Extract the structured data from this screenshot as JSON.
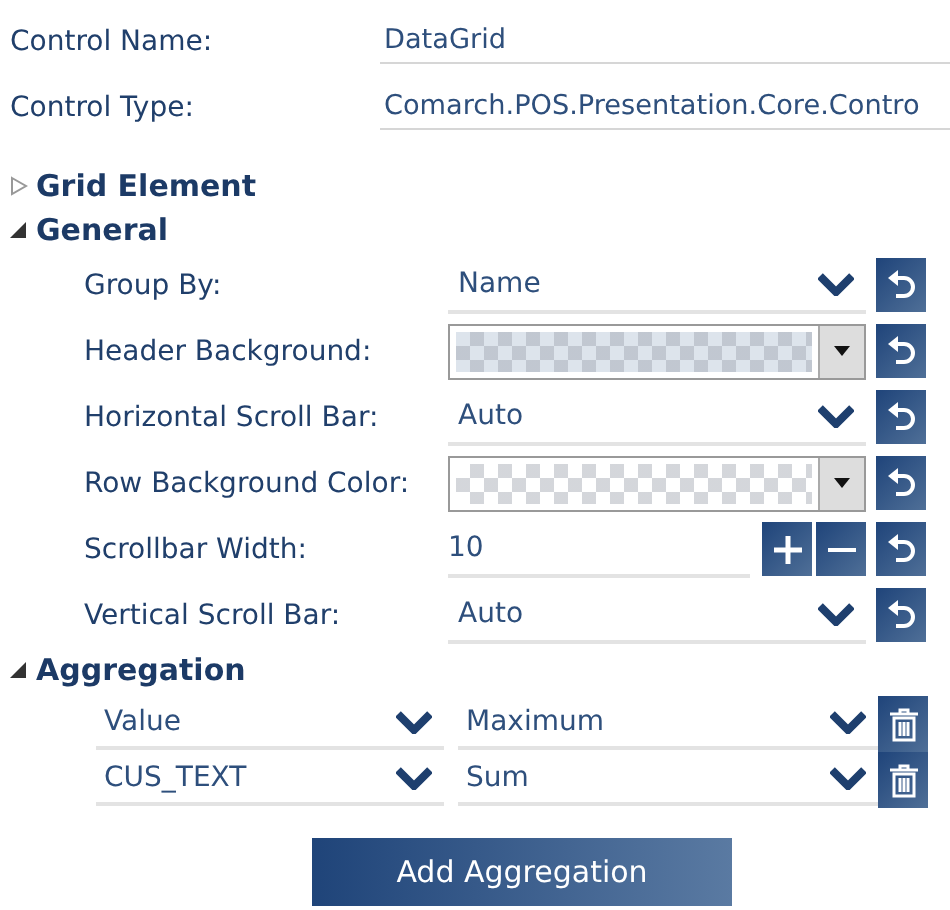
{
  "info": [
    {
      "label": "Control Name:",
      "value": "DataGrid"
    },
    {
      "label": "Control Type:",
      "value": "Comarch.POS.Presentation.Core.Contro"
    }
  ],
  "sections": [
    {
      "title": "Grid Element",
      "expanded": false
    },
    {
      "title": "General",
      "expanded": true,
      "properties": [
        {
          "label": "Group By:",
          "kind": "dropdown",
          "value": "Name"
        },
        {
          "label": "Header Background:",
          "kind": "color",
          "color": "#dde4ec"
        },
        {
          "label": "Horizontal Scroll Bar:",
          "kind": "dropdown",
          "value": "Auto"
        },
        {
          "label": "Row Background Color:",
          "kind": "color",
          "color": "#ffffff"
        },
        {
          "label": "Scrollbar Width:",
          "kind": "numeric",
          "value": "10"
        },
        {
          "label": "Vertical Scroll Bar:",
          "kind": "dropdown",
          "value": "Auto"
        }
      ]
    },
    {
      "title": "Aggregation",
      "expanded": true,
      "aggregations": [
        {
          "column": "Value",
          "function": "Maximum"
        },
        {
          "column": "CUS_TEXT",
          "function": "Sum"
        }
      ],
      "button": "Add Aggregation"
    }
  ]
}
